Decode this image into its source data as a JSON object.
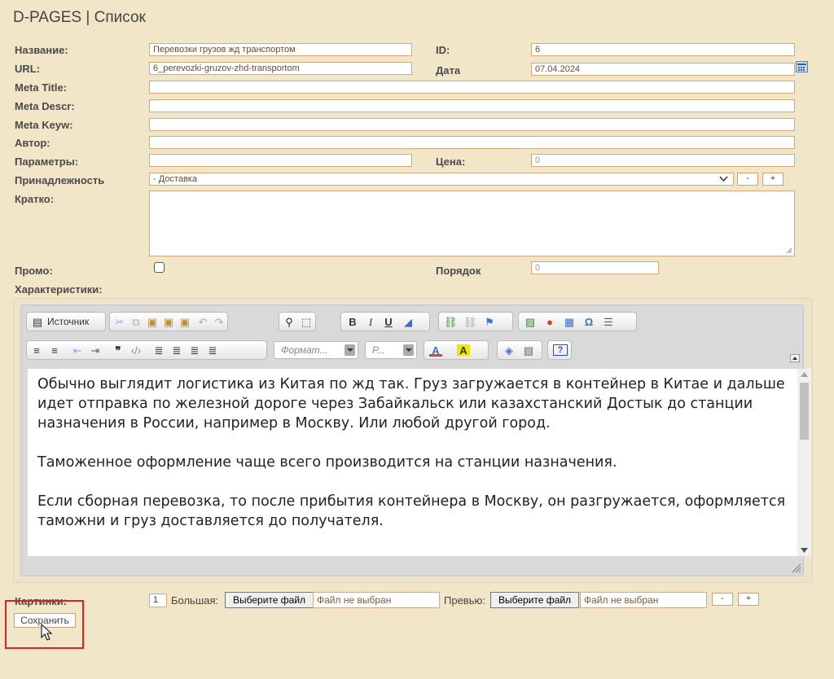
{
  "page_title": "D-PAGES | Список",
  "fields": {
    "name_label": "Название:",
    "name_value": "Перевозки грузов жд транспортом",
    "id_label": "ID:",
    "id_value": "6",
    "url_label": "URL:",
    "url_value": "6_perevozki-gruzov-zhd-transportom",
    "date_label": "Дата",
    "date_value": "07.04.2024",
    "meta_title_label": "Meta Title:",
    "meta_descr_label": "Meta Descr:",
    "meta_keyw_label": "Meta Keyw:",
    "author_label": "Автор:",
    "params_label": "Параметры:",
    "price_label": "Цена:",
    "price_value": "0",
    "belong_label": "Принадлежность",
    "belong_value": "- Доставка",
    "short_label": "Кратко:",
    "promo_label": "Промо:",
    "order_label": "Порядок",
    "order_value": "0",
    "features_label": "Характеристики:"
  },
  "buttons": {
    "minus": "-",
    "plus": "+",
    "save": "Сохранить"
  },
  "editor": {
    "source_label": "Источник",
    "format_placeholder": "Формат...",
    "font_placeholder": "Р...",
    "paragraphs": [
      "Обычно выглядит логистика из Китая по жд так. Груз загружается в контейнер в Китае и дальше идет отправка по железной дороге через Забайкальск или казахстанский Достык до станции назначения в России, например в Москву. Или любой другой город.",
      "Таможенное оформление чаще всего производится на станции назначения.",
      "Если сборная перевозка, то после прибытия контейнера в Москву, он разгружается, оформляется таможни и груз доставляется до получателя."
    ]
  },
  "images": {
    "label": "Картинки:",
    "count": "1",
    "large_label": "Большая:",
    "preview_label": "Превью:",
    "choose_file": "Выберите файл",
    "no_file": "Файл не выбран"
  }
}
